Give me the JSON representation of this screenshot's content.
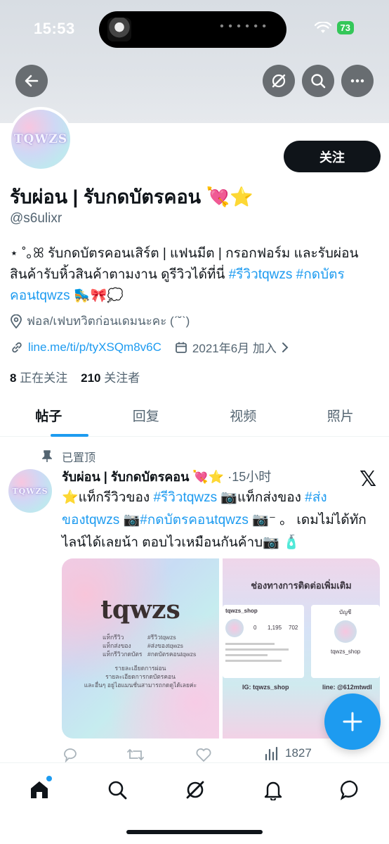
{
  "status_bar": {
    "time": "15:53",
    "battery": "73"
  },
  "profile": {
    "avatar_text": "TQWZS",
    "follow_label": "关注",
    "display_name": "รับผ่อน | รับกดบัตรคอน 💘⭐",
    "handle": "@s6ulixr",
    "bio_text": "⋆ ˚｡ꕤ รับกดบัตรคอนเสิร์ต | แฟนมีต | กรอกฟอร์ม และรับผ่อน สินค้ารับหิ้วสินค้าตามงาน ดูรีวิวได้ที่นี่ ",
    "bio_tag1": "#รีวิวtqwzs",
    "bio_tag2": "#กดบัตรคอนtqwzs",
    "bio_emoji": " 🛼🎀💭",
    "location": "ฟอล/เฟบทวิตก่อนเดมนะคะ (ˊ˘ˋ)",
    "link": "line.me/ti/p/tyXSQm8v6C",
    "joined": "2021年6月 加入",
    "following_count": "8",
    "following_label": "正在关注",
    "followers_count": "210",
    "followers_label": "关注者"
  },
  "tabs": [
    "帖子",
    "回复",
    "视频",
    "照片"
  ],
  "post": {
    "pinned_label": "已置顶",
    "author_name": "รับผ่อน | รับกดบัตรคอน 💘⭐",
    "time": "·15小时",
    "text_1": "⭐แท็กรีวิวของ ",
    "tag_1": "#รีวิวtqwzs",
    "text_2": " 📷แท็กส่งของ ",
    "tag_2": "#ส่งของtqwzs",
    "text_3": " 📷",
    "tag_3": "#กดบัตรคอนtqwzs",
    "text_4": " 📷⁻ 。 เดมไม่ได้ทักไลน์ได้เลยน้า ตอบไวเหมือนกันค้าบ📷 🧴",
    "media_a": {
      "brand": "tqwzs",
      "left_lines": [
        "แท็กรีวิว",
        "แท็กส่งของ",
        "แท็กรีวิวกดบัตร"
      ],
      "right_lines": [
        "#รีวิวtqwzs",
        "#ส่งของtqwzs",
        "#กดบัตรคอนtqwzs"
      ],
      "center_lines": [
        "รายละเอียดการผ่อน",
        "รายละเอียดการกดบัตรคอน",
        "และอื่นๆ อยู่ไฮแมนชั่นสามารถกดดูได้เลยค่ะ"
      ]
    },
    "media_b": {
      "title": "ช่องทางการติดต่อเพิ่มเติม",
      "ig_username": "tqwzs_shop",
      "ig_stats": [
        "0",
        "1,195",
        "702"
      ],
      "line_header": "บัญชี",
      "line_name": "tqwzs_shop",
      "ig_label": "IG: tqwzs_shop",
      "line_label": "line: @612mtwdl"
    },
    "views": "1827"
  },
  "icons": {
    "back": "back-arrow-icon",
    "grok": "grok-icon",
    "search": "search-icon",
    "more": "more-icon",
    "home": "home-icon",
    "notifications": "bell-icon",
    "messages": "message-icon"
  },
  "colors": {
    "accent": "#1d9bf0",
    "text": "#0f1419",
    "secondary": "#536471"
  }
}
